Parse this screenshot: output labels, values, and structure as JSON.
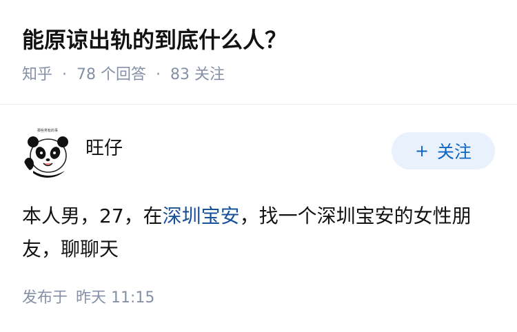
{
  "question": {
    "title": "能原谅出轨的到底什么人？",
    "source": "知乎",
    "answers": "78 个回答",
    "followers": "83 关注"
  },
  "answer": {
    "author_name": "旺仔",
    "avatar_banner_text": "那些男有的事",
    "follow_label": "关注",
    "follow_icon": "plus-icon",
    "content_before": "本人男，27，在",
    "content_link": "深圳宝安",
    "content_after": "，找一个深圳宝安的女性朋友，聊聊天",
    "posted_label": "发布于",
    "posted_time": "昨天 11:15"
  },
  "colors": {
    "meta_gray": "#8590a6",
    "link_blue": "#175199",
    "follow_bg": "#e8f1fc",
    "follow_text": "#0b66c2"
  }
}
